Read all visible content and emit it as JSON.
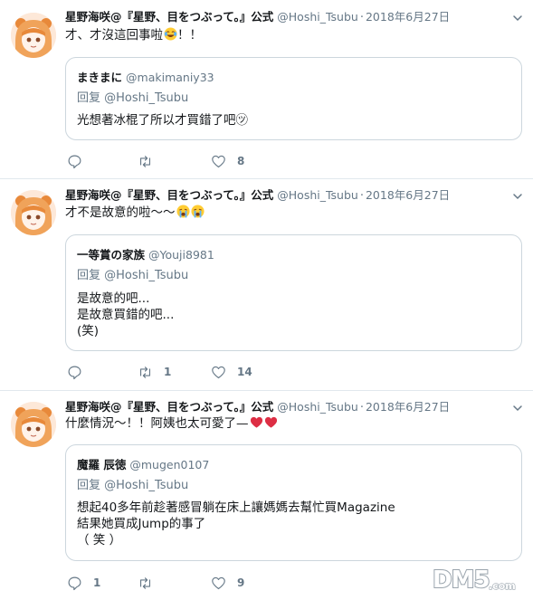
{
  "tweets": [
    {
      "author": {
        "name": "星野海咲@『星野、目をつぶって。』公式",
        "handle": "@Hoshi_Tsubu"
      },
      "date": "2018年6月27日",
      "text": "才、才沒這回事啦",
      "text_suffix": "！！",
      "emojis": [
        "joy-emoji"
      ],
      "quote": {
        "name": "まきまに",
        "handle": "@makimaniy33",
        "reply_to": "回复 @Hoshi_Tsubu",
        "lines": [
          "光想著冰棍了所以才買錯了吧㋡"
        ]
      },
      "stats": {
        "replies": "",
        "retweets": "",
        "likes": "8"
      }
    },
    {
      "author": {
        "name": "星野海咲@『星野、目をつぶって。』公式",
        "handle": "@Hoshi_Tsubu"
      },
      "date": "2018年6月27日",
      "text": "才不是故意的啦～～",
      "text_suffix": "",
      "emojis": [
        "crying-emoji",
        "crying-emoji"
      ],
      "quote": {
        "name": "一等賞の家族",
        "handle": "@Youji8981",
        "reply_to": "回复 @Hoshi_Tsubu",
        "lines": [
          "是故意的吧...",
          "是故意買錯的吧...",
          "(笑)"
        ]
      },
      "stats": {
        "replies": "",
        "retweets": "1",
        "likes": "14"
      }
    },
    {
      "author": {
        "name": "星野海咲@『星野、目をつぶって。』公式",
        "handle": "@Hoshi_Tsubu"
      },
      "date": "2018年6月27日",
      "text": "什麼情況～！！阿姨也太可愛了—",
      "text_suffix": "",
      "emojis": [
        "heart-emoji",
        "heart-emoji"
      ],
      "quote": {
        "name": "魔羅 辰徳",
        "handle": "@mugen0107",
        "reply_to": "回复 @Hoshi_Tsubu",
        "lines": [
          "想起40多年前趁著感冒躺在床上讓媽媽去幫忙買Magazine",
          "結果她買成Jump的事了",
          "（ 笑 ）"
        ]
      },
      "stats": {
        "replies": "1",
        "retweets": "",
        "likes": "9"
      }
    }
  ],
  "watermark": "DM5.com",
  "colors": {
    "text": "#14171a",
    "muted": "#657786",
    "border": "#ccd6dd",
    "divider": "#e1e8ed"
  }
}
